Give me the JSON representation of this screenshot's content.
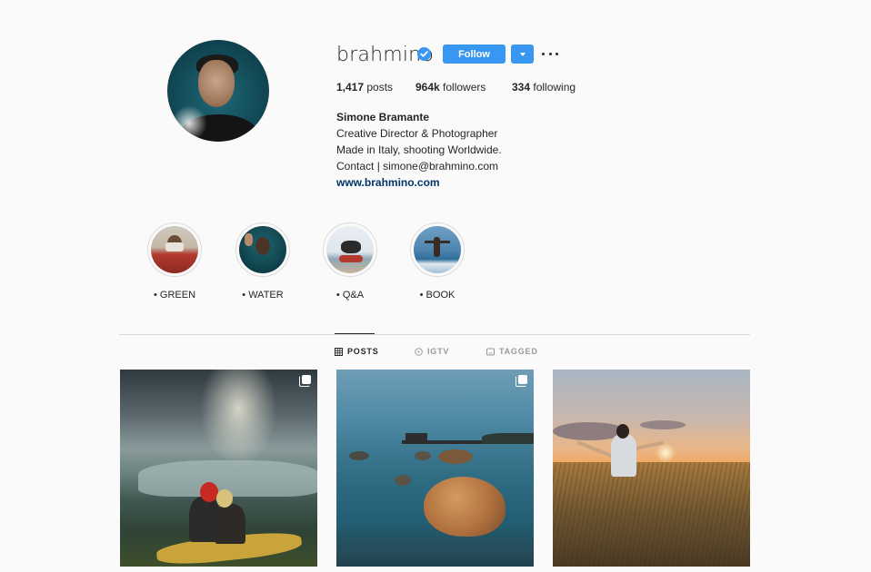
{
  "profile": {
    "username": "brahmino",
    "follow_label": "Follow",
    "stats": {
      "posts_count": "1,417",
      "posts_label": "posts",
      "followers_count": "964k",
      "followers_label": "followers",
      "following_count": "334",
      "following_label": "following"
    },
    "bio": {
      "name": "Simone Bramante",
      "line1": "Creative Director & Photographer",
      "line2": "Made in Italy, shooting Worldwide.",
      "line3": "Contact | simone@brahmino.com",
      "website": "www.brahmino.com"
    },
    "icons": [
      "verified-badge-icon",
      "chevron-down-icon",
      "more-options-icon"
    ]
  },
  "highlights": [
    {
      "label": "• GREEN"
    },
    {
      "label": "• WATER"
    },
    {
      "label": "• Q&A"
    },
    {
      "label": "• BOOK"
    }
  ],
  "tabs": [
    {
      "label": "POSTS",
      "icon": "grid-icon",
      "active": true
    },
    {
      "label": "IGTV",
      "icon": "igtv-icon",
      "active": false
    },
    {
      "label": "TAGGED",
      "icon": "tagged-icon",
      "active": false
    }
  ],
  "posts": [
    {
      "multiple": true
    },
    {
      "multiple": true
    },
    {
      "multiple": false
    }
  ],
  "colors": {
    "accent": "#3897f0",
    "link": "#003569",
    "background": "#fafafa",
    "text": "#262626",
    "muted": "#999999"
  }
}
